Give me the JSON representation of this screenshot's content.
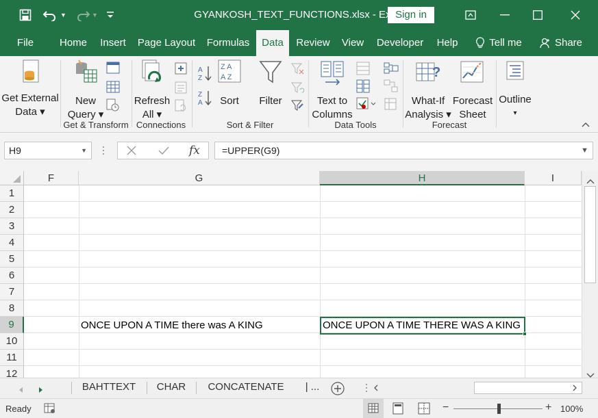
{
  "window": {
    "title": "GYANKOSH_TEXT_FUNCTIONS.xlsx  -  Excel",
    "sign_in_label": "Sign in"
  },
  "ribbon_tabs": [
    {
      "label": "File"
    },
    {
      "label": "Home"
    },
    {
      "label": "Insert"
    },
    {
      "label": "Page Layout"
    },
    {
      "label": "Formulas"
    },
    {
      "label": "Data"
    },
    {
      "label": "Review"
    },
    {
      "label": "View"
    },
    {
      "label": "Developer"
    },
    {
      "label": "Help"
    },
    {
      "label": "Tell me"
    },
    {
      "label": "Share"
    }
  ],
  "ribbon": {
    "get_external_data": [
      "Get External",
      "Data ▾"
    ],
    "new_query": [
      "New",
      "Query ▾"
    ],
    "refresh_all": [
      "Refresh",
      "All ▾"
    ],
    "sort": "Sort",
    "filter": "Filter",
    "text_to_columns": [
      "Text to",
      "Columns"
    ],
    "what_if": [
      "What-If",
      "Analysis ▾"
    ],
    "forecast_sheet": [
      "Forecast",
      "Sheet"
    ],
    "outline": [
      "Outline",
      "▾"
    ],
    "groups": {
      "get_transform": "Get & Transform",
      "connections": "Connections",
      "sort_filter": "Sort & Filter",
      "data_tools": "Data Tools",
      "forecast": "Forecast"
    }
  },
  "formula_bar": {
    "name_box": "H9",
    "fx": "fx",
    "formula": "=UPPER(G9)"
  },
  "grid": {
    "columns": [
      "F",
      "G",
      "H",
      "I"
    ],
    "selected_column": "H",
    "rows": [
      "1",
      "2",
      "3",
      "4",
      "5",
      "6",
      "7",
      "8",
      "9",
      "10",
      "11",
      "12"
    ],
    "selected_row": "9",
    "cells": {
      "G9": "ONCE UPON A TIME there was  A KING",
      "H9": "ONCE UPON A TIME THERE WAS  A KING"
    }
  },
  "sheet_tabs": [
    {
      "label": "BAHTTEXT"
    },
    {
      "label": "CHAR"
    },
    {
      "label": "CONCATENATE"
    },
    {
      "label": "| ..."
    }
  ],
  "status": {
    "ready": "Ready",
    "zoom": "100%"
  }
}
